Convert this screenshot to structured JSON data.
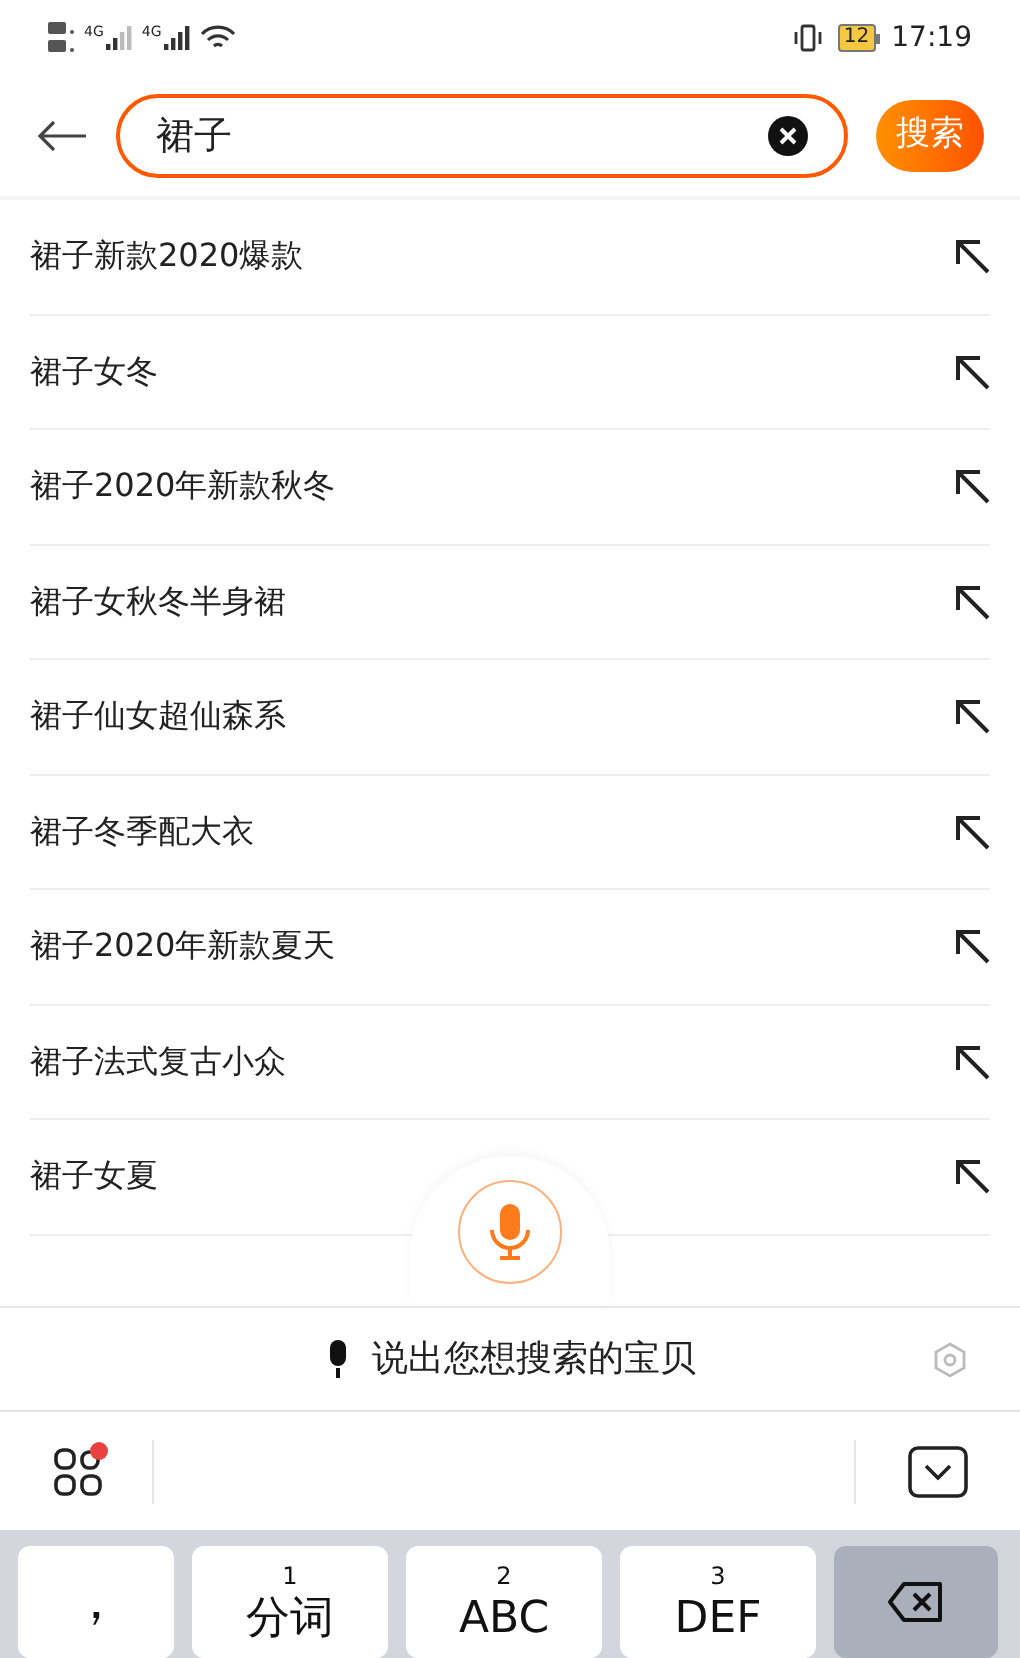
{
  "status_bar": {
    "network_labels": [
      "4G",
      "4G"
    ],
    "battery": "12",
    "time": "17:19"
  },
  "search": {
    "value": "裙子",
    "button": "搜索"
  },
  "suggestions": [
    {
      "text": "裙子新款2020爆款"
    },
    {
      "text": "裙子女冬"
    },
    {
      "text": "裙子2020年新款秋冬"
    },
    {
      "text": "裙子女秋冬半身裙"
    },
    {
      "text": "裙子仙女超仙森系"
    },
    {
      "text": "裙子冬季配大衣"
    },
    {
      "text": "裙子2020年新款夏天"
    },
    {
      "text": "裙子法式复古小众"
    },
    {
      "text": "裙子女夏"
    }
  ],
  "voice_bar": {
    "hint": "说出您想搜索的宝贝"
  },
  "keyboard_toolbar": {
    "notification": true
  },
  "keys": [
    {
      "kind": "punct",
      "label": "，"
    },
    {
      "kind": "letter",
      "number": "1",
      "label": "分词"
    },
    {
      "kind": "letter",
      "number": "2",
      "label": "ABC"
    },
    {
      "kind": "letter",
      "number": "3",
      "label": "DEF"
    },
    {
      "kind": "delete"
    }
  ]
}
